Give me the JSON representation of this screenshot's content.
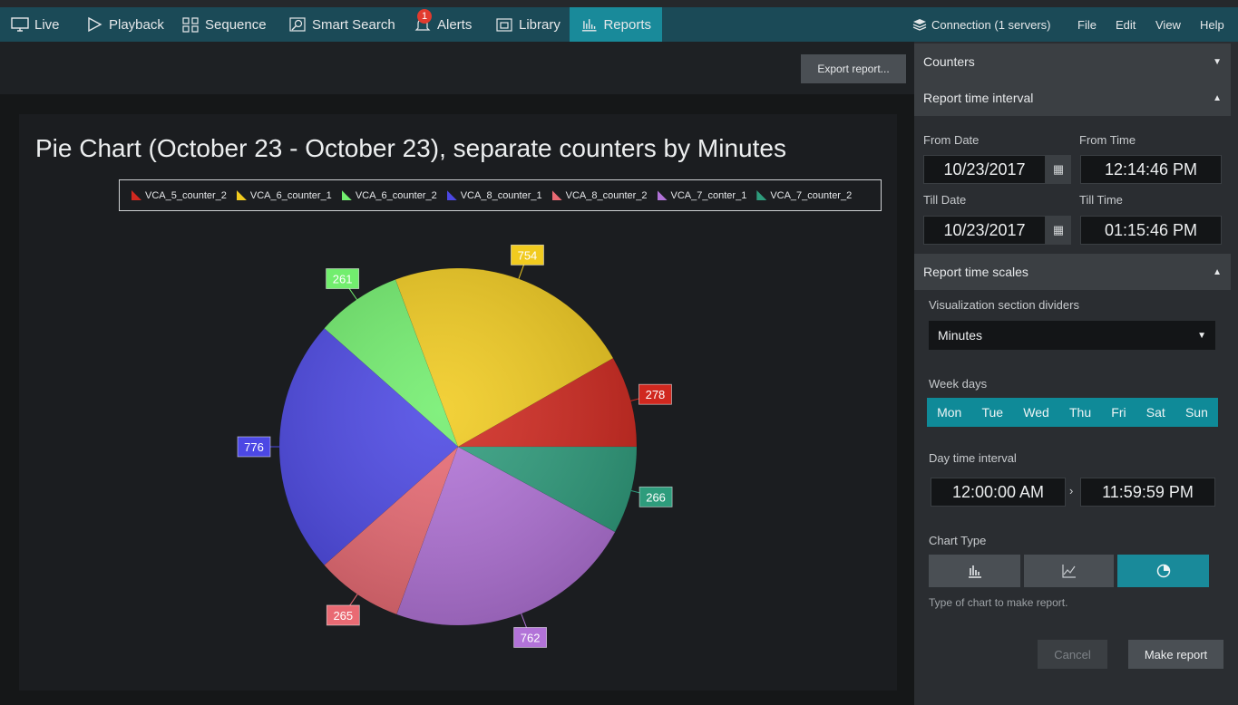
{
  "nav": {
    "live": "Live",
    "playback": "Playback",
    "sequence": "Sequence",
    "smart_search": "Smart Search",
    "alerts": "Alerts",
    "alerts_badge": "1",
    "library": "Library",
    "reports": "Reports"
  },
  "menu": {
    "connection": "Connection (1 servers)",
    "file": "File",
    "edit": "Edit",
    "view": "View",
    "help": "Help"
  },
  "toolbar": {
    "export_label": "Export report..."
  },
  "chart_data": {
    "type": "pie",
    "title": "Pie Chart (October 23 - October 23), separate counters by Minutes",
    "legend_position": "top",
    "series": [
      {
        "name": "VCA_5_counter_2",
        "value": 278,
        "color": "#d0281f"
      },
      {
        "name": "VCA_6_counter_1",
        "value": 754,
        "color": "#f1cb1f"
      },
      {
        "name": "VCA_6_counter_2",
        "value": 261,
        "color": "#72ee6e"
      },
      {
        "name": "VCA_8_counter_1",
        "value": 776,
        "color": "#4c48e4"
      },
      {
        "name": "VCA_8_counter_2",
        "value": 265,
        "color": "#e96a73"
      },
      {
        "name": "VCA_7_conter_1",
        "value": 762,
        "color": "#b273d8"
      },
      {
        "name": "VCA_7_counter_2",
        "value": 266,
        "color": "#2e9c7c"
      }
    ]
  },
  "sidebar": {
    "counters": "Counters",
    "report_time_interval": "Report time interval",
    "from_date_label": "From Date",
    "from_date": "10/23/2017",
    "from_time_label": "From Time",
    "from_time": "12:14:46 PM",
    "till_date_label": "Till Date",
    "till_date": "10/23/2017",
    "till_time_label": "Till Time",
    "till_time": "01:15:46 PM",
    "report_time_scales": "Report time scales",
    "visualization_label": "Visualization section dividers",
    "visualization_value": "Minutes",
    "week_days_label": "Week days",
    "week_days": [
      "Mon",
      "Tue",
      "Wed",
      "Thu",
      "Fri",
      "Sat",
      "Sun"
    ],
    "day_time_label": "Day time interval",
    "day_time_start": "12:00:00 AM",
    "day_time_end": "11:59:59 PM",
    "chart_type_label": "Chart Type",
    "chart_type_hint": "Type of chart to make report.",
    "cancel": "Cancel",
    "make_report": "Make report"
  },
  "colors": {
    "accent": "#198a9a",
    "topbar": "#1b4a57"
  }
}
